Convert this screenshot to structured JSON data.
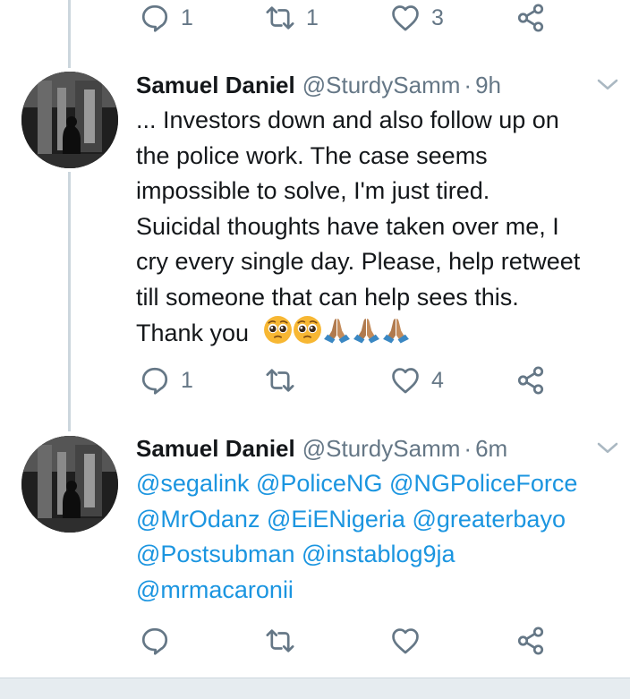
{
  "tweets": [
    {
      "actions": {
        "reply_count": "1",
        "retweet_count": "1",
        "like_count": "3"
      }
    },
    {
      "author_name": "Samuel Daniel",
      "handle": "@SturdySamm",
      "separator": "·",
      "time": "9h",
      "lines": [
        "... Investors down and also follow up on",
        "the police work. The case seems",
        "impossible to solve, I'm just tired.",
        "Suicidal thoughts have taken over me, I",
        "cry every single day. Please, help retweet",
        "till someone that can help sees this.",
        "Thank you"
      ],
      "emojis": [
        "pleading-face",
        "pleading-face",
        "folded-hands",
        "folded-hands",
        "folded-hands"
      ],
      "actions": {
        "reply_count": "1",
        "retweet_count": "",
        "like_count": "4"
      }
    },
    {
      "author_name": "Samuel Daniel",
      "handle": "@SturdySamm",
      "separator": "·",
      "time": "6m",
      "mention_lines": [
        [
          "@segalink",
          "@PoliceNG",
          "@NGPoliceForce"
        ],
        [
          "@MrOdanz",
          "@EiENigeria",
          "@greaterbayo"
        ],
        [
          "@Postsubman",
          "@instablog9ja"
        ],
        [
          "@mrmacaronii"
        ]
      ],
      "actions": {
        "reply_count": "",
        "retweet_count": "",
        "like_count": ""
      }
    }
  ],
  "colors": {
    "text": "#14171a",
    "secondary": "#657786",
    "mention": "#1b95e0",
    "thread_line": "#ccd6dd",
    "emoji_face": "#f7b733",
    "hands": "#b07a4e"
  }
}
